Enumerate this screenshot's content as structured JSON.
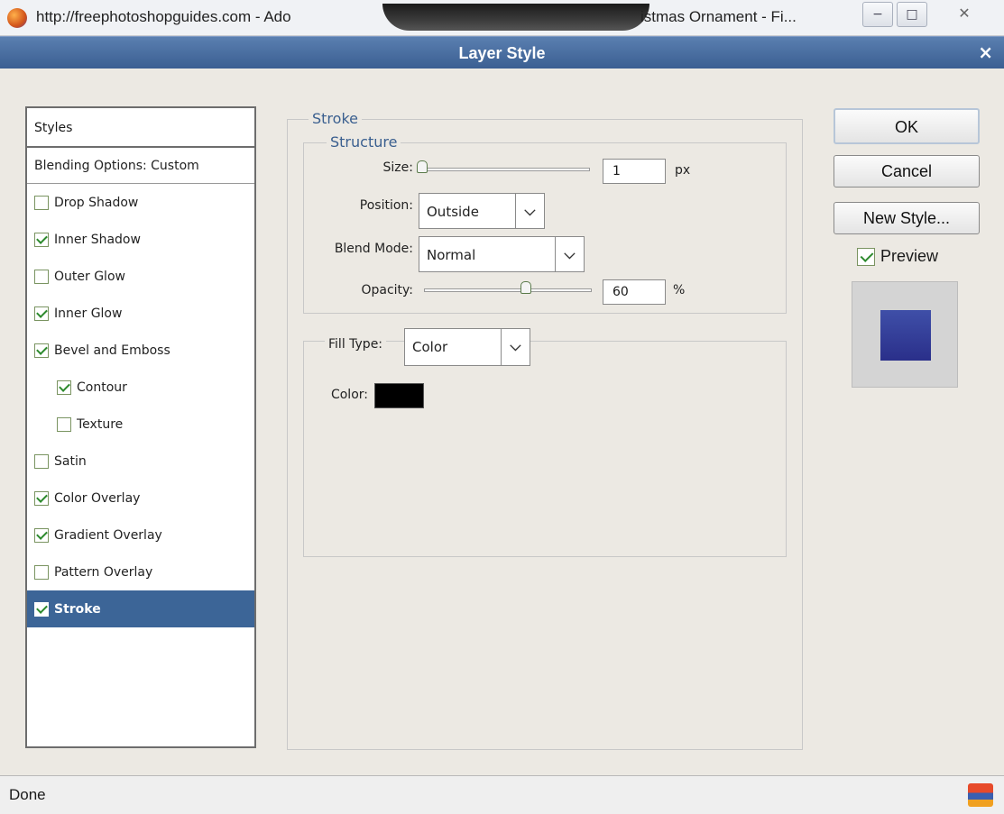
{
  "browser": {
    "title": "http://freephotoshopguides.com - Ado",
    "title_tail": "istmas Ornament - Fi..."
  },
  "dialog": {
    "title": "Layer Style",
    "close": "×"
  },
  "styles_panel": {
    "header": "Styles",
    "blending": "Blending Options: Custom",
    "items": [
      {
        "label": "Drop Shadow",
        "checked": false
      },
      {
        "label": "Inner Shadow",
        "checked": true
      },
      {
        "label": "Outer Glow",
        "checked": false
      },
      {
        "label": "Inner Glow",
        "checked": true
      },
      {
        "label": "Bevel and Emboss",
        "checked": true
      },
      {
        "label": "Contour",
        "checked": true
      },
      {
        "label": "Texture",
        "checked": false
      },
      {
        "label": "Satin",
        "checked": false
      },
      {
        "label": "Color Overlay",
        "checked": true
      },
      {
        "label": "Gradient Overlay",
        "checked": true
      },
      {
        "label": "Pattern Overlay",
        "checked": false
      },
      {
        "label": "Stroke",
        "checked": true
      }
    ]
  },
  "stroke": {
    "legend": "Stroke",
    "structure_legend": "Structure",
    "size_label": "Size:",
    "size_value": "1",
    "size_unit": "px",
    "position_label": "Position:",
    "position_value": "Outside",
    "blend_label": "Blend Mode:",
    "blend_value": "Normal",
    "opacity_label": "Opacity:",
    "opacity_value": "60",
    "opacity_unit": "%",
    "fill_type_label": "Fill Type:",
    "fill_type_value": "Color",
    "color_label": "Color:",
    "color_value": "#000000"
  },
  "buttons": {
    "ok": "OK",
    "cancel": "Cancel",
    "new_style": "New Style...",
    "preview": "Preview"
  },
  "status": {
    "text": "Done"
  }
}
